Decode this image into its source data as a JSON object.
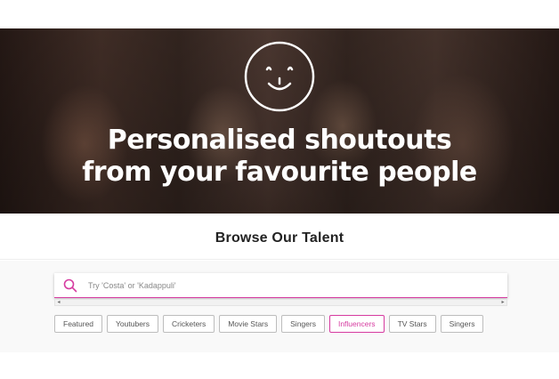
{
  "hero": {
    "title_line1": "Personalised shoutouts",
    "title_line2": "from your favourite people",
    "icon": "smiley-face-icon"
  },
  "browse": {
    "title": "Browse Our Talent"
  },
  "search": {
    "placeholder": "Try 'Costa' or 'Kadappuli'",
    "value": "",
    "icon": "search-icon"
  },
  "scrollbar": {
    "left_arrow": "◂",
    "right_arrow": "▸"
  },
  "categories": [
    {
      "label": "Featured",
      "active": false
    },
    {
      "label": "Youtubers",
      "active": false
    },
    {
      "label": "Cricketers",
      "active": false
    },
    {
      "label": "Movie Stars",
      "active": false
    },
    {
      "label": "Singers",
      "active": false
    },
    {
      "label": "Influencers",
      "active": true
    },
    {
      "label": "TV Stars",
      "active": false
    },
    {
      "label": "Singers",
      "active": false
    }
  ],
  "colors": {
    "accent": "#d63ba0",
    "tag_border": "#bdbdbd",
    "hero_text": "#ffffff"
  }
}
